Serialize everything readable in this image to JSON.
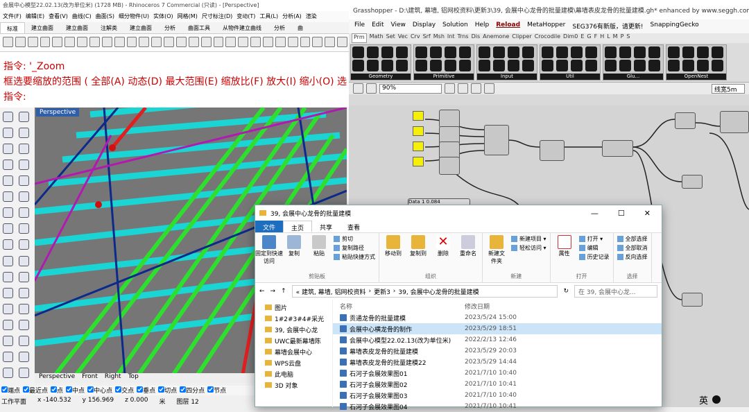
{
  "rhino": {
    "title": "会展中心模型22.02.13(改为单位米) (1728 MB) - Rhinoceros 7 Commercial (只读) - [Perspective]",
    "menu": [
      "文件(F)",
      "编辑(E)",
      "查看(V)",
      "曲线(C)",
      "曲面(S)",
      "细分物件(U)",
      "实体(O)",
      "网格(M)",
      "尺寸标注(D)",
      "变动(T)",
      "工具(L)",
      "分析(A)",
      "渲染"
    ],
    "tabs": [
      "标准",
      "建立曲面",
      "建立曲面",
      "注解类",
      "建立曲面",
      "分析",
      "曲面工具",
      "从物件建立曲线",
      "分析",
      "曲"
    ],
    "command": {
      "line1": "指令: '_Zoom",
      "line2": "框选要缩放的范围 ( 全部(A)  动态(D)  最大范围(E)  缩放比(F)  放大(I)  缩小(O)  选",
      "line3": "指令:"
    },
    "viewport_label": "Perspective",
    "view_tabs": [
      "Perspective",
      "Front",
      "Right",
      "Top"
    ],
    "snaps": [
      "端点",
      "最近点",
      "点",
      "中点",
      "中心点",
      "交点",
      "垂点",
      "切点",
      "四分点",
      "节点"
    ],
    "coords": {
      "x": "x -140.532",
      "y": "y 156.969",
      "z": "z 0.000",
      "unit": "米",
      "layer": "图层 12",
      "status": "工作平面"
    }
  },
  "grasshopper": {
    "title": "Grasshopper - D:\\建筑, 幕墙, 铝网校资料\\更新3\\39, 会展中心龙骨的批量建模\\幕墙表皮龙骨的批量建模.gh*  enhanced by www.seggh.com",
    "menu": [
      "File",
      "Edit",
      "View",
      "Display",
      "Solution",
      "Help",
      "Reload",
      "MetaHopper",
      "SEG376有新版，请更新!",
      "SnappingGecko"
    ],
    "tabs": [
      "Prm",
      "Math",
      "Set",
      "Vec",
      "Crv",
      "Srf",
      "Msh",
      "Int",
      "Trns",
      "Dis",
      "Anemone",
      "Clipper",
      "Crocodile",
      "Dim0",
      "E",
      "G",
      "F",
      "H",
      "L",
      "M",
      "P",
      "S"
    ],
    "ribbon_groups": [
      "Geometry",
      "Primitive",
      "Input",
      "Util",
      "Glu...",
      "OpenNest"
    ],
    "zoom": "90%",
    "display_mode": "线宽5m",
    "data_label": "Data 1",
    "data_value": "0.084"
  },
  "explorer": {
    "title": "39, 会展中心龙骨的批量建模",
    "ribbon_tabs": [
      "文件",
      "主页",
      "共享",
      "查看"
    ],
    "clipboard": {
      "pin": "固定到快速访问",
      "copy": "复制",
      "paste": "粘贴",
      "cut": "剪切",
      "copy_path": "复制路径",
      "paste_shortcut": "粘贴快捷方式",
      "label": "剪贴板"
    },
    "organize": {
      "move": "移动到",
      "copy_to": "复制到",
      "delete": "删除",
      "rename": "重命名",
      "label": "组织"
    },
    "new": {
      "folder": "新建文件夹",
      "item": "新建项目 ▾",
      "easy": "轻松访问 ▾",
      "label": "新建"
    },
    "open": {
      "props": "属性",
      "open": "打开 ▾",
      "edit": "编辑",
      "history": "历史记录",
      "label": "打开"
    },
    "select": {
      "all": "全部选择",
      "none": "全部取消",
      "invert": "反向选择",
      "label": "选择"
    },
    "address": [
      "« 建筑, 幕墙, 铝网校资料",
      "更新3",
      "39, 会展中心龙骨的批量建模"
    ],
    "search_placeholder": "在 39, 会展中心龙...",
    "nav": [
      "图片",
      "1#2#3#4#采光",
      "39, 会展中心龙",
      "UWC最新幕墙陈",
      "幕墙会展中心",
      "WPS云盘",
      "此电脑",
      "3D 对象"
    ],
    "headers": {
      "name": "名称",
      "date": "修改日期"
    },
    "files": [
      {
        "name": "贡通龙骨的批量建模",
        "date": "2023/5/24 15:00"
      },
      {
        "name": "会展中心横龙骨的制作",
        "date": "2023/5/29 18:51"
      },
      {
        "name": "会展中心模型22.02.13(改为单位米)",
        "date": "2022/2/13 12:46"
      },
      {
        "name": "幕墙表皮龙骨的批量建模",
        "date": "2023/5/29 20:03"
      },
      {
        "name": "幕墙表皮龙骨的批量建模22",
        "date": "2023/5/29 14:44"
      },
      {
        "name": "石河子会展效果图01",
        "date": "2021/7/10 10:40"
      },
      {
        "name": "石河子会展效果图02",
        "date": "2021/7/10 10:41"
      },
      {
        "name": "石河子会展效果图03",
        "date": "2021/7/10 10:40"
      },
      {
        "name": "石河子会展效果图04",
        "date": "2021/7/10 10:41"
      }
    ]
  },
  "taskbar": {
    "ime": "英"
  }
}
